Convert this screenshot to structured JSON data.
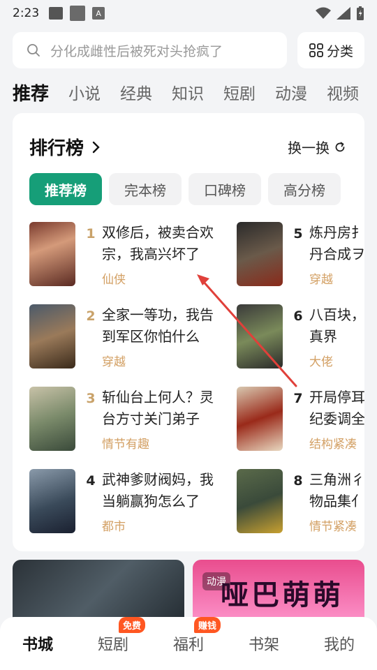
{
  "status_bar": {
    "time": "2:23",
    "a_label": "A"
  },
  "search": {
    "placeholder": "分化成雌性后被死对头抢疯了"
  },
  "category_button": {
    "label": "分类"
  },
  "top_tabs": [
    "推荐",
    "小说",
    "经典",
    "知识",
    "短剧",
    "动漫",
    "视频"
  ],
  "ranking": {
    "title": "排行榜",
    "refresh_label": "换一换",
    "pills": [
      "推荐榜",
      "完本榜",
      "口碑榜",
      "高分榜"
    ],
    "books": [
      {
        "rank": "1",
        "title": "双修后，被卖合欢宗，我高兴坏了",
        "tag": "仙侠"
      },
      {
        "rank": "2",
        "title": "全家一等功，我告到军区你怕什么",
        "tag": "穿越"
      },
      {
        "rank": "3",
        "title": "斩仙台上何人？灵台方寸关门弟子",
        "tag": "情节有趣"
      },
      {
        "rank": "4",
        "title": "武神爹财阀妈，我当躺赢狗怎么了",
        "tag": "都市"
      },
      {
        "rank": "5",
        "title": "炼丹房扌丹合成ヲ",
        "title_line1": "炼丹房扌",
        "title_line2": "丹合成ヲ",
        "tag": "穿越"
      },
      {
        "rank": "6",
        "title": "八百块，真界",
        "title_line1": "八百块，",
        "title_line2": "真界",
        "tag": "大佬"
      },
      {
        "rank": "7",
        "title": "开局停职纪委调查",
        "title_line1": "开局停耳",
        "title_line2": "纪委调全",
        "tag": "结构紧凑"
      },
      {
        "rank": "8",
        "title": "三角洲行物品集体",
        "title_line1": "三角洲彳",
        "title_line2": "物品集亻",
        "tag": "情节紧凑"
      }
    ]
  },
  "promos": {
    "right_badge": "动漫",
    "right_title": "哑巴萌萌"
  },
  "bottom_nav": [
    {
      "label": "书城",
      "badge": ""
    },
    {
      "label": "短剧",
      "badge": "免费"
    },
    {
      "label": "福利",
      "badge": "赚钱"
    },
    {
      "label": "书架",
      "badge": ""
    },
    {
      "label": "我的",
      "badge": ""
    }
  ],
  "colors": {
    "accent": "#169e78",
    "tag": "#d3a064",
    "badge": "#ff5722"
  }
}
